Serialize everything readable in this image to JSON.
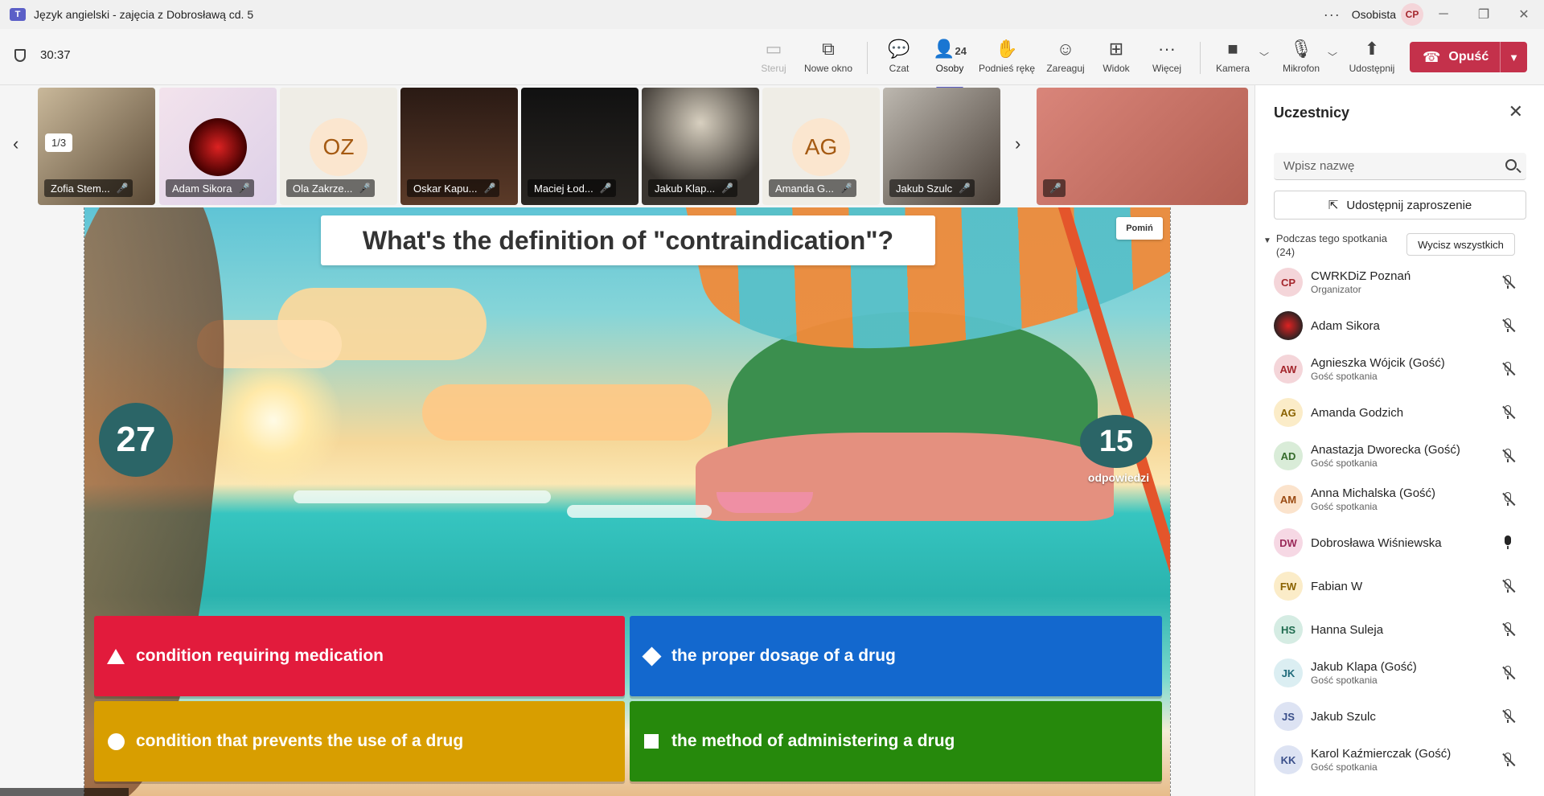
{
  "window": {
    "title": "Język angielski - zajęcia z Dobrosławą cd. 5",
    "profile": "Osobista",
    "profile_initials": "CP"
  },
  "toolbar": {
    "timer": "30:37",
    "steruj": "Steruj",
    "nowe_okno": "Nowe okno",
    "czat": "Czat",
    "osoby": "Osoby",
    "osoby_count": "24",
    "podnies_reke": "Podnieś rękę",
    "zareaguj": "Zareaguj",
    "widok": "Widok",
    "wiecej": "Więcej",
    "kamera": "Kamera",
    "mikrofon": "Mikrofon",
    "udostepnij": "Udostępnij",
    "opusc": "Opuść"
  },
  "strip": {
    "page_indicator": "1/3",
    "tiles": [
      {
        "name": "Zofia Stem..."
      },
      {
        "name": "Adam Sikora"
      },
      {
        "name": "Ola Zakrze...",
        "initials": "OZ"
      },
      {
        "name": "Oskar Kapu..."
      },
      {
        "name": "Maciej Łod..."
      },
      {
        "name": "Jakub Klap..."
      },
      {
        "name": "Amanda G...",
        "initials": "AG"
      },
      {
        "name": "Jakub Szulc"
      }
    ]
  },
  "quiz": {
    "question": "What's the definition of \"contraindication\"?",
    "skip_label": "Pomiń",
    "timer": "27",
    "answers_count": "15",
    "answers_label": "odpowiedzi",
    "answers": [
      {
        "text": "condition requiring medication",
        "color": "#e21b3c",
        "shape": "triangle"
      },
      {
        "text": "the proper dosage of a drug",
        "color": "#1368ce",
        "shape": "diamond"
      },
      {
        "text": "condition that prevents the use of a drug",
        "color": "#d89e00",
        "shape": "circle"
      },
      {
        "text": "the method of administering a drug",
        "color": "#26890c",
        "shape": "square"
      }
    ]
  },
  "panel": {
    "title": "Uczestnicy",
    "search_placeholder": "Wpisz nazwę",
    "invite_label": "Udostępnij zaproszenie",
    "section_label": "Podczas tego spotkania (24)",
    "mute_all_label": "Wycisz wszystkich",
    "participants": [
      {
        "initials": "CP",
        "name": "CWRKDiZ Poznań",
        "sub": "Organizator",
        "mic": "off"
      },
      {
        "initials": "",
        "name": "Adam Sikora",
        "sub": "",
        "mic": "off"
      },
      {
        "initials": "AW",
        "name": "Agnieszka Wójcik (Gość)",
        "sub": "Gość spotkania",
        "mic": "off"
      },
      {
        "initials": "AG",
        "name": "Amanda Godzich",
        "sub": "",
        "mic": "off"
      },
      {
        "initials": "AD",
        "name": "Anastazja Dworecka (Gość)",
        "sub": "Gość spotkania",
        "mic": "off"
      },
      {
        "initials": "AM",
        "name": "Anna Michalska (Gość)",
        "sub": "Gość spotkania",
        "mic": "off"
      },
      {
        "initials": "DW",
        "name": "Dobrosława Wiśniewska",
        "sub": "",
        "mic": "on"
      },
      {
        "initials": "FW",
        "name": "Fabian W",
        "sub": "",
        "mic": "off"
      },
      {
        "initials": "HS",
        "name": "Hanna Suleja",
        "sub": "",
        "mic": "off"
      },
      {
        "initials": "JK",
        "name": "Jakub Klapa (Gość)",
        "sub": "Gość spotkania",
        "mic": "off"
      },
      {
        "initials": "JS",
        "name": "Jakub Szulc",
        "sub": "",
        "mic": "off"
      },
      {
        "initials": "KK",
        "name": "Karol Kaźmierczak (Gość)",
        "sub": "Gość spotkania",
        "mic": "off"
      }
    ]
  }
}
